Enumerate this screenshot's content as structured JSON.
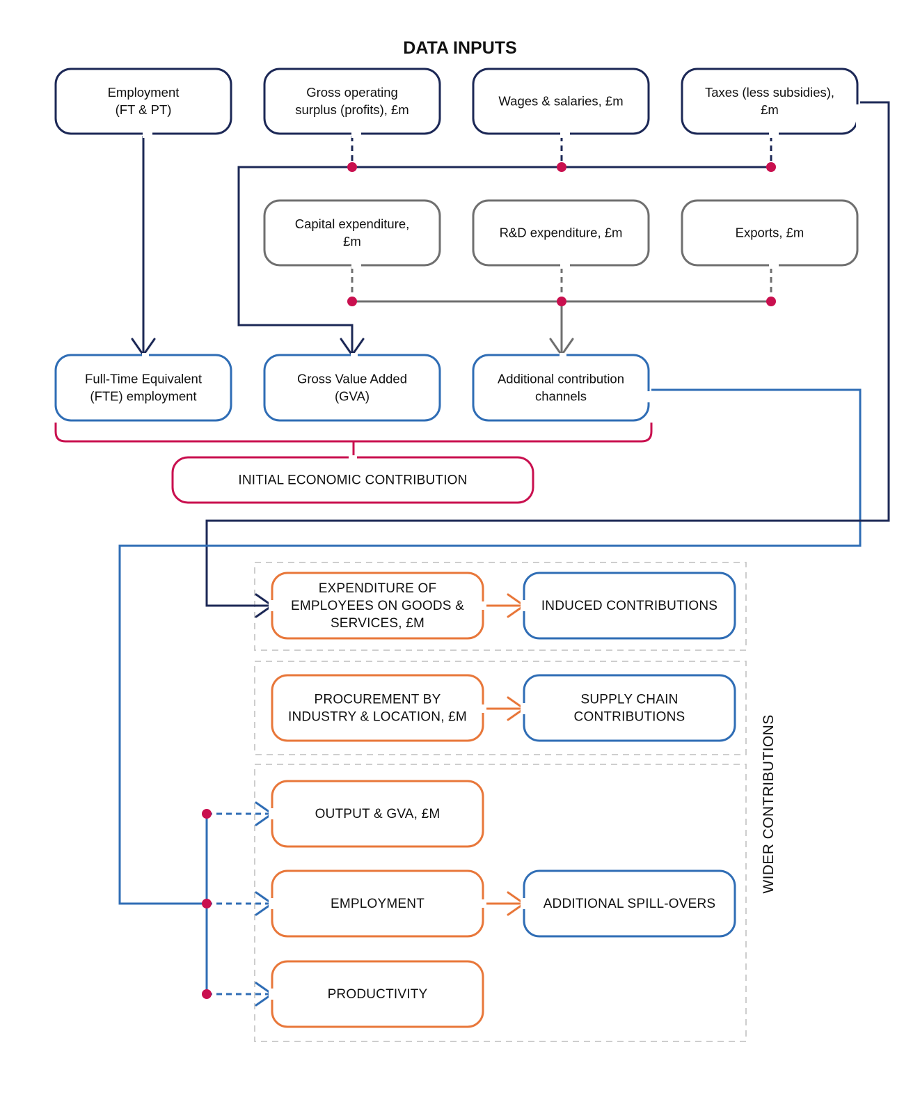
{
  "colors": {
    "navy": "#1c2856",
    "grey": "#6f6f6f",
    "blue": "#2f6db5",
    "magenta": "#c9104f",
    "orange": "#e8773a",
    "dashed_group": "#c8c8c8",
    "text": "#111111"
  },
  "header": {
    "title": "DATA INPUTS"
  },
  "data_inputs": {
    "row1": [
      {
        "id": "employment-ft-pt",
        "lines": [
          "Employment",
          "(FT & PT)"
        ]
      },
      {
        "id": "gross-operating-surplus",
        "lines": [
          "Gross operating",
          "surplus (profits), £m"
        ]
      },
      {
        "id": "wages-salaries",
        "lines": [
          "Wages & salaries, £m"
        ]
      },
      {
        "id": "taxes-less-subsidies",
        "lines": [
          "Taxes (less subsidies),",
          "£m"
        ]
      }
    ],
    "row2": [
      {
        "id": "capital-expenditure",
        "lines": [
          "Capital expenditure,",
          "£m"
        ]
      },
      {
        "id": "rd-expenditure",
        "lines": [
          "R&D expenditure, £m"
        ]
      },
      {
        "id": "exports",
        "lines": [
          "Exports, £m"
        ]
      }
    ]
  },
  "initial_outputs": [
    {
      "id": "fte-employment",
      "lines": [
        "Full-Time Equivalent",
        "(FTE) employment"
      ]
    },
    {
      "id": "gross-value-added",
      "lines": [
        "Gross Value Added",
        "(GVA)"
      ]
    },
    {
      "id": "additional-contribution-channels",
      "lines": [
        "Additional contribution",
        "channels"
      ]
    }
  ],
  "initial_contribution": {
    "label": "INITIAL ECONOMIC CONTRIBUTION"
  },
  "wider_contributions": {
    "section_label": "WIDER CONTRIBUTIONS",
    "groups": [
      {
        "inputs": [
          {
            "id": "expenditure-of-employees",
            "lines": [
              "EXPENDITURE OF",
              "EMPLOYEES ON GOODS &",
              "SERVICES, £M"
            ]
          }
        ],
        "result": {
          "id": "induced-contributions",
          "lines": [
            "INDUCED CONTRIBUTIONS"
          ]
        }
      },
      {
        "inputs": [
          {
            "id": "procurement-by-industry",
            "lines": [
              "PROCUREMENT BY",
              "INDUSTRY & LOCATION, £M"
            ]
          }
        ],
        "result": {
          "id": "supply-chain-contributions",
          "lines": [
            "SUPPLY CHAIN",
            "CONTRIBUTIONS"
          ]
        }
      },
      {
        "inputs": [
          {
            "id": "output-gva",
            "lines": [
              "OUTPUT & GVA, £M"
            ]
          },
          {
            "id": "employment-wider",
            "lines": [
              "EMPLOYMENT"
            ]
          },
          {
            "id": "productivity",
            "lines": [
              "PRODUCTIVITY"
            ]
          }
        ],
        "result": {
          "id": "additional-spill-overs",
          "lines": [
            "ADDITIONAL SPILL-OVERS"
          ]
        }
      }
    ]
  }
}
